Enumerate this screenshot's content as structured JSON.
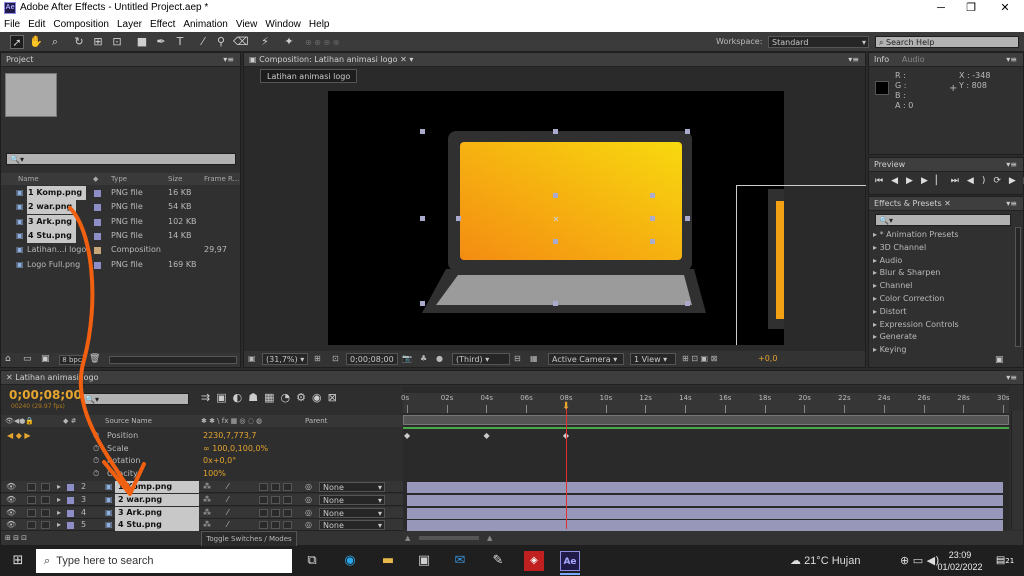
{
  "window": {
    "app_badge": "Ae",
    "title": "Adobe After Effects - Untitled Project.aep *",
    "minimize": "─",
    "maximize": "❐",
    "close": "✕"
  },
  "menu": [
    "File",
    "Edit",
    "Composition",
    "Layer",
    "Effect",
    "Animation",
    "View",
    "Window",
    "Help"
  ],
  "workspace": {
    "label": "Workspace:",
    "value": "Standard"
  },
  "search_help": {
    "placeholder": "Search Help"
  },
  "project": {
    "tab": "Project",
    "search_placeholder": "🔍▾",
    "columns": {
      "name": "Name",
      "type": "Type",
      "size": "Size",
      "frame_rate": "Frame R..."
    },
    "items": [
      {
        "name": "1 Komp.png",
        "type": "PNG file",
        "size": "16 KB",
        "frame_rate": "",
        "selected": true,
        "color": "#8d8dc7"
      },
      {
        "name": "2 war.png",
        "type": "PNG file",
        "size": "54 KB",
        "frame_rate": "",
        "selected": true,
        "color": "#8d8dc7"
      },
      {
        "name": "3 Ark.png",
        "type": "PNG file",
        "size": "102 KB",
        "frame_rate": "",
        "selected": true,
        "color": "#8d8dc7"
      },
      {
        "name": "4 Stu.png",
        "type": "PNG file",
        "size": "14 KB",
        "frame_rate": "",
        "selected": true,
        "color": "#8d8dc7"
      },
      {
        "name": "Latihan...i logo",
        "type": "Composition",
        "size": "",
        "frame_rate": "29,97",
        "selected": false,
        "color": "#c7a77a"
      },
      {
        "name": "Logo Full.png",
        "type": "PNG file",
        "size": "169 KB",
        "frame_rate": "",
        "selected": false,
        "color": "#8d8dc7"
      }
    ],
    "bpc": "8 bpc"
  },
  "composition": {
    "tab": "Composition: Latihan animasi logo",
    "subtab": "Latihan animasi logo",
    "zoom": "(31,7%)",
    "timecode": "0;00;08;00",
    "view": "(Third)",
    "camera": "Active Camera",
    "views": "1 View",
    "exposure": "+0,0"
  },
  "info": {
    "tab_info": "Info",
    "tab_audio": "Audio",
    "r": "R :",
    "g": "G :",
    "b": "B :",
    "a": "A : 0",
    "x": "X : -348",
    "y": "Y : 808"
  },
  "preview": {
    "tab": "Preview"
  },
  "effects": {
    "tab": "Effects & Presets",
    "search_placeholder": "🔍▾",
    "items": [
      "* Animation Presets",
      "3D Channel",
      "Audio",
      "Blur & Sharpen",
      "Channel",
      "Color Correction",
      "Distort",
      "Expression Controls",
      "Generate",
      "Keying"
    ]
  },
  "timeline": {
    "tab": "Latihan animasi logo",
    "timecode": "0;00;08;00",
    "frames": "00240 (29.97 fps)",
    "search_placeholder": "🔍▾",
    "col_source": "Source Name",
    "col_parent": "Parent",
    "ruler": [
      "0s",
      "02s",
      "04s",
      "06s",
      "08s",
      "10s",
      "12s",
      "14s",
      "16s",
      "18s",
      "20s",
      "22s",
      "24s",
      "26s",
      "28s",
      "30s"
    ],
    "playhead_seconds": 8,
    "duration_seconds": 30,
    "properties": [
      {
        "name": "Position",
        "value": "2230,7,773,7"
      },
      {
        "name": "Scale",
        "value": "∞ 100,0,100,0%"
      },
      {
        "name": "Rotation",
        "value": "0x+0,0°"
      },
      {
        "name": "Opacity",
        "value": "100%"
      }
    ],
    "keyframes_seconds": [
      0,
      4,
      8
    ],
    "layers": [
      {
        "num": "2",
        "name": "1 Komp.png",
        "parent": "None"
      },
      {
        "num": "3",
        "name": "2 war.png",
        "parent": "None"
      },
      {
        "num": "4",
        "name": "3 Ark.png",
        "parent": "None"
      },
      {
        "num": "5",
        "name": "4 Stu.png",
        "parent": "None"
      }
    ],
    "toggle_label": "Toggle Switches / Modes"
  },
  "taskbar": {
    "search_placeholder": "Type here to search",
    "weather": "21°C  Hujan",
    "time": "23:09",
    "date": "01/02/2022",
    "notifications": "21"
  }
}
